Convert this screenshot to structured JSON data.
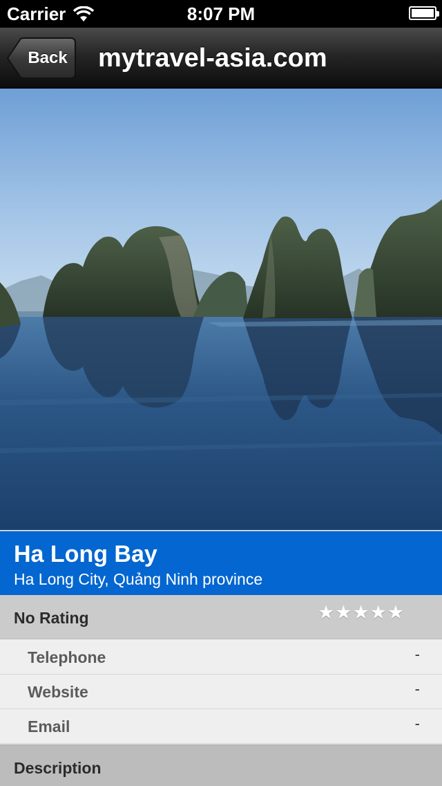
{
  "status_bar": {
    "carrier": "Carrier",
    "time": "8:07 PM"
  },
  "nav": {
    "back_label": "Back",
    "title": "mytravel-asia.com"
  },
  "gallery": {
    "page_count": 1,
    "current_page": 1
  },
  "place": {
    "name": "Ha Long Bay",
    "location": "Ha Long City, Quảng Ninh province"
  },
  "rating": {
    "label": "No Rating",
    "stars_total": 5,
    "stars_filled": 0
  },
  "details": [
    {
      "label": "Telephone",
      "value": "-"
    },
    {
      "label": "Website",
      "value": "-"
    },
    {
      "label": "Email",
      "value": "-"
    }
  ],
  "description": {
    "label": "Description"
  },
  "colors": {
    "header_band": "#0466d0",
    "nav_bar": "#262626"
  }
}
